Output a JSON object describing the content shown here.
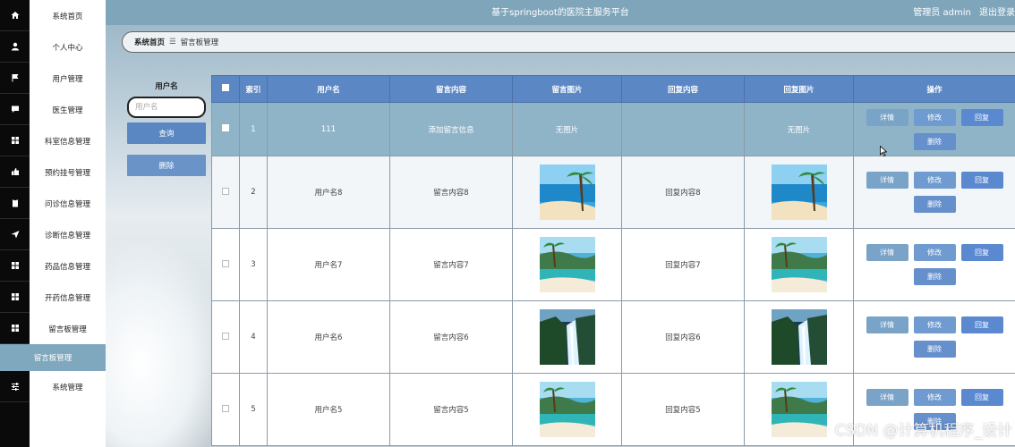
{
  "header": {
    "title": "基于springboot的医院主服务平台",
    "role": "管理员 admin",
    "logout": "退出登录"
  },
  "sidebar": {
    "items": [
      {
        "label": "系统首页",
        "icon": "home-icon"
      },
      {
        "label": "个人中心",
        "icon": "user-icon"
      },
      {
        "label": "用户管理",
        "icon": "flag-icon"
      },
      {
        "label": "医生管理",
        "icon": "chat-icon"
      },
      {
        "label": "科室信息管理",
        "icon": "grid-icon"
      },
      {
        "label": "预约挂号管理",
        "icon": "thumb-icon"
      },
      {
        "label": "问诊信息管理",
        "icon": "clipboard-icon"
      },
      {
        "label": "诊断信息管理",
        "icon": "send-icon"
      },
      {
        "label": "药品信息管理",
        "icon": "grid-icon"
      },
      {
        "label": "开药信息管理",
        "icon": "grid-icon"
      },
      {
        "label": "留言板管理",
        "icon": "grid-icon"
      }
    ],
    "sub_item": "留言板管理",
    "system_item": {
      "label": "系统管理",
      "icon": "sliders-icon"
    }
  },
  "breadcrumb": {
    "home": "系统首页",
    "separator": "☰",
    "current": "留言板管理"
  },
  "search": {
    "label": "用户名",
    "placeholder": "用户名",
    "query_button": "查询",
    "delete_button": "删除"
  },
  "table": {
    "headers": [
      "",
      "索引",
      "用户名",
      "留言内容",
      "留言图片",
      "回复内容",
      "回复图片",
      "操作"
    ],
    "rows": [
      {
        "index": "1",
        "username": "111",
        "content": "添加留言信息",
        "image": "无图片",
        "reply": "",
        "reply_image": "无图片"
      },
      {
        "index": "2",
        "username": "用户名8",
        "content": "留言内容8",
        "image": "beach",
        "reply": "回复内容8",
        "reply_image": "beach"
      },
      {
        "index": "3",
        "username": "用户名7",
        "content": "留言内容7",
        "image": "island",
        "reply": "回复内容7",
        "reply_image": "island"
      },
      {
        "index": "4",
        "username": "用户名6",
        "content": "留言内容6",
        "image": "waterfall",
        "reply": "回复内容6",
        "reply_image": "waterfall"
      },
      {
        "index": "5",
        "username": "用户名5",
        "content": "留言内容5",
        "image": "island",
        "reply": "回复内容5",
        "reply_image": "island"
      }
    ],
    "actions": {
      "detail": "详情",
      "edit": "修改",
      "reply": "回复",
      "delete": "删除"
    }
  },
  "watermark": "CSDN @计算机程序_设计",
  "colors": {
    "header": "#7fa5bb",
    "button": "#5a86c2",
    "highlight_row": "#8fb4c8",
    "sidebar_icon_bg": "#0a0a0a"
  }
}
